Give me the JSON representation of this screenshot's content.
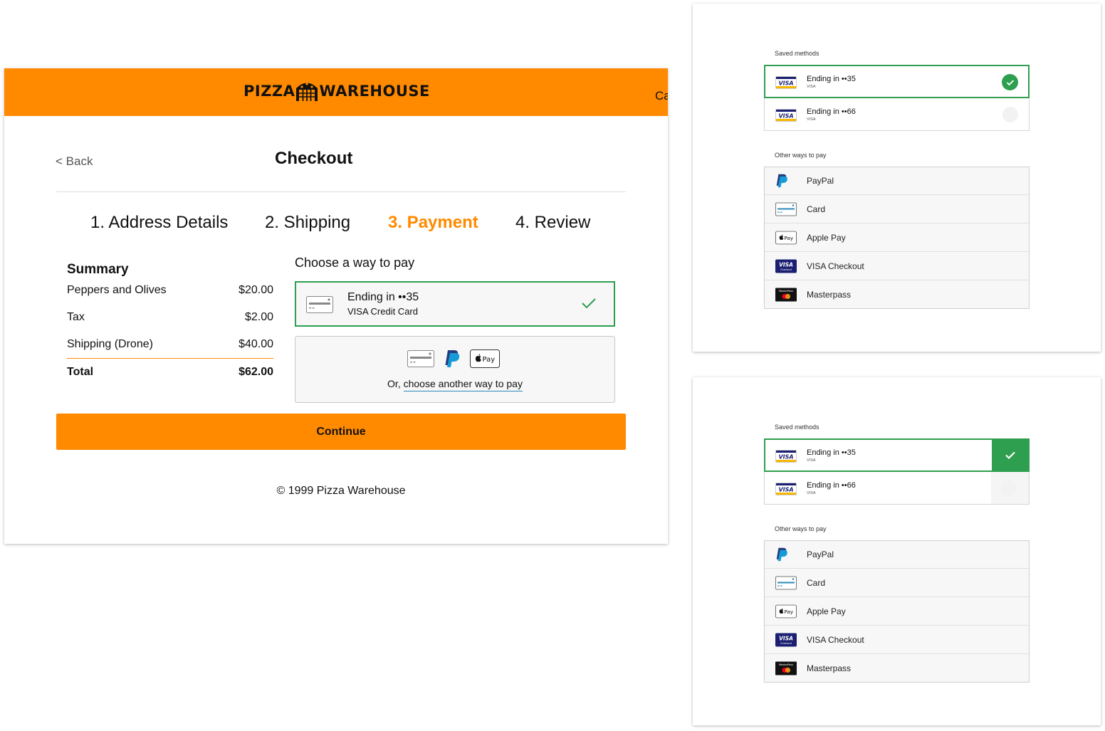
{
  "header": {
    "brand_left": "PIZZA",
    "brand_right": "WAREHOUSE",
    "cart_clipped": "Ca"
  },
  "nav": {
    "back": "< Back",
    "title": "Checkout"
  },
  "steps": [
    {
      "label": "1. Address Details",
      "active": false
    },
    {
      "label": "2. Shipping",
      "active": false
    },
    {
      "label": "3. Payment",
      "active": true
    },
    {
      "label": "4. Review",
      "active": false
    }
  ],
  "summary": {
    "title": "Summary",
    "items": [
      {
        "name": "Peppers and Olives",
        "price": "$20.00"
      },
      {
        "name": "Tax",
        "price": "$2.00"
      },
      {
        "name": "Shipping (Drone)",
        "price": "$40.00"
      }
    ],
    "total": {
      "name": "Total",
      "price": "$62.00"
    }
  },
  "payment": {
    "heading": "Choose a way to pay",
    "selected": {
      "line1": "Ending in ••35",
      "line2": "VISA Credit Card"
    },
    "other": {
      "prefix": "Or, ",
      "link": "choose another way to pay",
      "icons": [
        "card-icon",
        "paypal-icon",
        "apple-pay-icon"
      ]
    }
  },
  "continue_label": "Continue",
  "footer": {
    "copyright": "© 1999 Pizza Warehouse"
  },
  "variants": [
    {
      "saved_label": "Saved methods",
      "saved": [
        {
          "line1": "Ending in ••35",
          "brand": "VISA",
          "selected": true
        },
        {
          "line1": "Ending in ••66",
          "brand": "VISA",
          "selected": false
        }
      ],
      "other_label": "Other ways to pay",
      "others": [
        {
          "label": "PayPal",
          "icon": "paypal-icon"
        },
        {
          "label": "Card",
          "icon": "card-icon"
        },
        {
          "label": "Apple Pay",
          "icon": "apple-pay-icon"
        },
        {
          "label": "VISA Checkout",
          "icon": "visa-checkout-icon"
        },
        {
          "label": "Masterpass",
          "icon": "masterpass-icon"
        }
      ]
    },
    {
      "saved_label": "Saved methods",
      "saved": [
        {
          "line1": "Ending in ••35",
          "brand": "VISA",
          "selected": true
        },
        {
          "line1": "Ending in ••66",
          "brand": "VISA",
          "selected": false
        }
      ],
      "other_label": "Other ways to pay",
      "others": [
        {
          "label": "PayPal",
          "icon": "paypal-icon"
        },
        {
          "label": "Card",
          "icon": "card-icon"
        },
        {
          "label": "Apple Pay",
          "icon": "apple-pay-icon"
        },
        {
          "label": "VISA Checkout",
          "icon": "visa-checkout-icon"
        },
        {
          "label": "Masterpass",
          "icon": "masterpass-icon"
        }
      ]
    }
  ],
  "colors": {
    "brand_orange": "#ff8a00",
    "success_green": "#2e9e4f",
    "link_blue": "#2a8ab8"
  }
}
